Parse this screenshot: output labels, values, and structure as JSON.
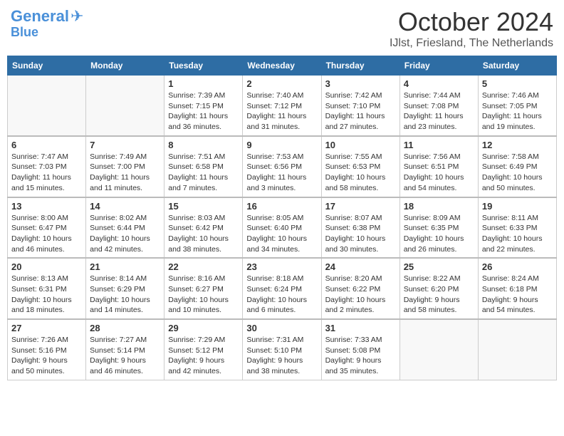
{
  "header": {
    "logo_line1": "General",
    "logo_line2": "Blue",
    "month": "October 2024",
    "location": "IJlst, Friesland, The Netherlands"
  },
  "weekdays": [
    "Sunday",
    "Monday",
    "Tuesday",
    "Wednesday",
    "Thursday",
    "Friday",
    "Saturday"
  ],
  "weeks": [
    [
      {
        "day": "",
        "info": ""
      },
      {
        "day": "",
        "info": ""
      },
      {
        "day": "1",
        "info": "Sunrise: 7:39 AM\nSunset: 7:15 PM\nDaylight: 11 hours\nand 36 minutes."
      },
      {
        "day": "2",
        "info": "Sunrise: 7:40 AM\nSunset: 7:12 PM\nDaylight: 11 hours\nand 31 minutes."
      },
      {
        "day": "3",
        "info": "Sunrise: 7:42 AM\nSunset: 7:10 PM\nDaylight: 11 hours\nand 27 minutes."
      },
      {
        "day": "4",
        "info": "Sunrise: 7:44 AM\nSunset: 7:08 PM\nDaylight: 11 hours\nand 23 minutes."
      },
      {
        "day": "5",
        "info": "Sunrise: 7:46 AM\nSunset: 7:05 PM\nDaylight: 11 hours\nand 19 minutes."
      }
    ],
    [
      {
        "day": "6",
        "info": "Sunrise: 7:47 AM\nSunset: 7:03 PM\nDaylight: 11 hours\nand 15 minutes."
      },
      {
        "day": "7",
        "info": "Sunrise: 7:49 AM\nSunset: 7:00 PM\nDaylight: 11 hours\nand 11 minutes."
      },
      {
        "day": "8",
        "info": "Sunrise: 7:51 AM\nSunset: 6:58 PM\nDaylight: 11 hours\nand 7 minutes."
      },
      {
        "day": "9",
        "info": "Sunrise: 7:53 AM\nSunset: 6:56 PM\nDaylight: 11 hours\nand 3 minutes."
      },
      {
        "day": "10",
        "info": "Sunrise: 7:55 AM\nSunset: 6:53 PM\nDaylight: 10 hours\nand 58 minutes."
      },
      {
        "day": "11",
        "info": "Sunrise: 7:56 AM\nSunset: 6:51 PM\nDaylight: 10 hours\nand 54 minutes."
      },
      {
        "day": "12",
        "info": "Sunrise: 7:58 AM\nSunset: 6:49 PM\nDaylight: 10 hours\nand 50 minutes."
      }
    ],
    [
      {
        "day": "13",
        "info": "Sunrise: 8:00 AM\nSunset: 6:47 PM\nDaylight: 10 hours\nand 46 minutes."
      },
      {
        "day": "14",
        "info": "Sunrise: 8:02 AM\nSunset: 6:44 PM\nDaylight: 10 hours\nand 42 minutes."
      },
      {
        "day": "15",
        "info": "Sunrise: 8:03 AM\nSunset: 6:42 PM\nDaylight: 10 hours\nand 38 minutes."
      },
      {
        "day": "16",
        "info": "Sunrise: 8:05 AM\nSunset: 6:40 PM\nDaylight: 10 hours\nand 34 minutes."
      },
      {
        "day": "17",
        "info": "Sunrise: 8:07 AM\nSunset: 6:38 PM\nDaylight: 10 hours\nand 30 minutes."
      },
      {
        "day": "18",
        "info": "Sunrise: 8:09 AM\nSunset: 6:35 PM\nDaylight: 10 hours\nand 26 minutes."
      },
      {
        "day": "19",
        "info": "Sunrise: 8:11 AM\nSunset: 6:33 PM\nDaylight: 10 hours\nand 22 minutes."
      }
    ],
    [
      {
        "day": "20",
        "info": "Sunrise: 8:13 AM\nSunset: 6:31 PM\nDaylight: 10 hours\nand 18 minutes."
      },
      {
        "day": "21",
        "info": "Sunrise: 8:14 AM\nSunset: 6:29 PM\nDaylight: 10 hours\nand 14 minutes."
      },
      {
        "day": "22",
        "info": "Sunrise: 8:16 AM\nSunset: 6:27 PM\nDaylight: 10 hours\nand 10 minutes."
      },
      {
        "day": "23",
        "info": "Sunrise: 8:18 AM\nSunset: 6:24 PM\nDaylight: 10 hours\nand 6 minutes."
      },
      {
        "day": "24",
        "info": "Sunrise: 8:20 AM\nSunset: 6:22 PM\nDaylight: 10 hours\nand 2 minutes."
      },
      {
        "day": "25",
        "info": "Sunrise: 8:22 AM\nSunset: 6:20 PM\nDaylight: 9 hours\nand 58 minutes."
      },
      {
        "day": "26",
        "info": "Sunrise: 8:24 AM\nSunset: 6:18 PM\nDaylight: 9 hours\nand 54 minutes."
      }
    ],
    [
      {
        "day": "27",
        "info": "Sunrise: 7:26 AM\nSunset: 5:16 PM\nDaylight: 9 hours\nand 50 minutes."
      },
      {
        "day": "28",
        "info": "Sunrise: 7:27 AM\nSunset: 5:14 PM\nDaylight: 9 hours\nand 46 minutes."
      },
      {
        "day": "29",
        "info": "Sunrise: 7:29 AM\nSunset: 5:12 PM\nDaylight: 9 hours\nand 42 minutes."
      },
      {
        "day": "30",
        "info": "Sunrise: 7:31 AM\nSunset: 5:10 PM\nDaylight: 9 hours\nand 38 minutes."
      },
      {
        "day": "31",
        "info": "Sunrise: 7:33 AM\nSunset: 5:08 PM\nDaylight: 9 hours\nand 35 minutes."
      },
      {
        "day": "",
        "info": ""
      },
      {
        "day": "",
        "info": ""
      }
    ]
  ]
}
